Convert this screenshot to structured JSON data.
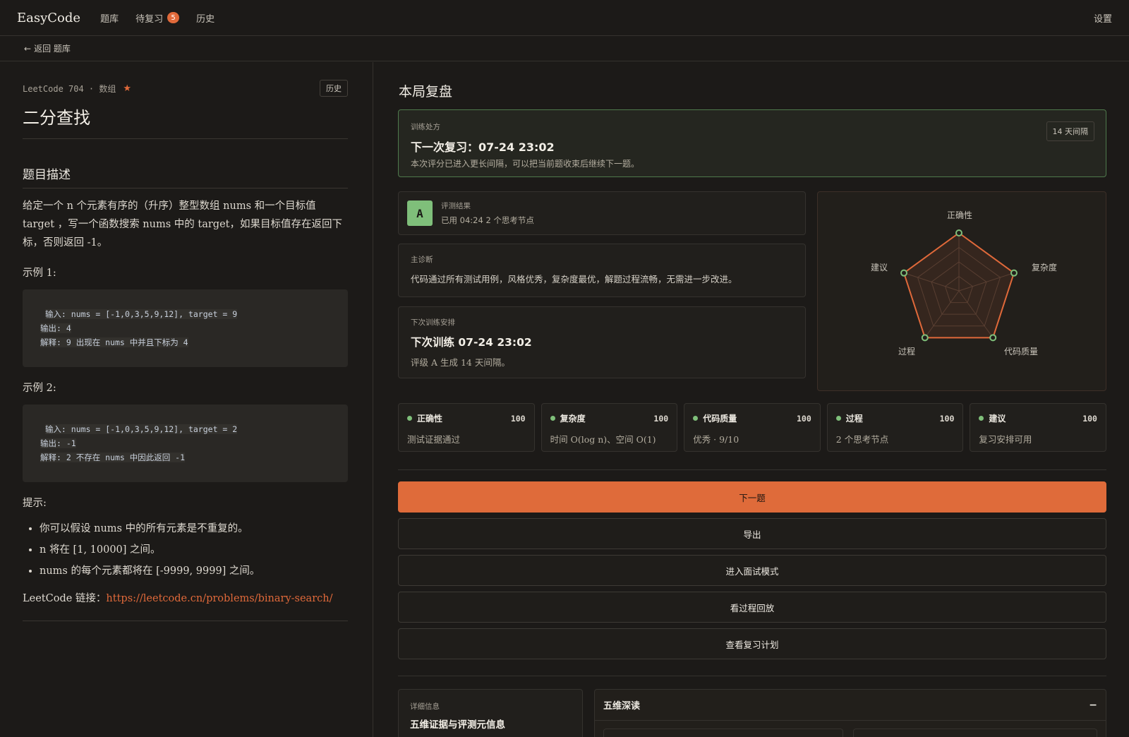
{
  "header": {
    "brand": "EasyCode",
    "nav": [
      {
        "label": "题库"
      },
      {
        "label": "待复习",
        "badge": "5"
      },
      {
        "label": "历史"
      }
    ],
    "settings": "设置"
  },
  "subbar": {
    "back_arrow": "←",
    "back_label": "返回 题库"
  },
  "problem": {
    "meta": "LeetCode 704 · 数组",
    "star": "★",
    "history_button": "历史",
    "title": "二分查找",
    "section_title": "题目描述",
    "description": "给定一个 n 个元素有序的（升序）整型数组 nums 和一个目标值 target ，写一个函数搜索 nums 中的 target，如果目标值存在返回下标，否则返回 -1。",
    "examples": [
      {
        "label": "示例 1:",
        "input": "输入: nums = [-1,0,3,5,9,12], target = 9",
        "output": "输出: 4",
        "explain": "解释: 9 出现在 nums 中并且下标为 4"
      },
      {
        "label": "示例 2:",
        "input": "输入: nums = [-1,0,3,5,9,12], target = 2",
        "output": "输出: -1",
        "explain": "解释: 2 不存在 nums 中因此返回 -1"
      }
    ],
    "tips_label": "提示:",
    "tips": [
      "你可以假设 nums 中的所有元素是不重复的。",
      "n 将在 [1, 10000] 之间。",
      "nums 的每个元素都将在 [-9999, 9999] 之间。"
    ],
    "link_label": "LeetCode 链接：",
    "link_url": "https://leetcode.cn/problems/binary-search/"
  },
  "review": {
    "heading": "本局复盘",
    "prescription": {
      "label": "训练处方",
      "title": "下一次复习：07-24 23:02",
      "subtitle": "本次评分已进入更长间隔，可以把当前题收束后继续下一题。",
      "interval": "14 天间隔"
    },
    "result": {
      "grade": "A",
      "label": "评测结果",
      "sub": "已用 04:24  2 个思考节点"
    },
    "diagnosis": {
      "label": "主诊断",
      "text": "代码通过所有测试用例，风格优秀，复杂度最优，解题过程流畅，无需进一步改进。"
    },
    "next": {
      "label": "下次训练安排",
      "title": "下次训练 07-24 23:02",
      "sub": "评级 A 生成 14 天间隔。"
    },
    "radar": {
      "axes": [
        "正确性",
        "复杂度",
        "代码质量",
        "过程",
        "建议"
      ],
      "values": [
        100,
        100,
        100,
        100,
        100
      ],
      "max": 100,
      "color": "#e0693a",
      "point_color": "#7fbf7a"
    },
    "dimensions": [
      {
        "name": "正确性",
        "score": "100",
        "sub": "测试证据通过"
      },
      {
        "name": "复杂度",
        "score": "100",
        "sub": "时间 O(log n)、空间 O(1)"
      },
      {
        "name": "代码质量",
        "score": "100",
        "sub": "优秀 · 9/10"
      },
      {
        "name": "过程",
        "score": "100",
        "sub": "2 个思考节点"
      },
      {
        "name": "建议",
        "score": "100",
        "sub": "复习安排可用"
      }
    ],
    "actions": [
      "下一题",
      "导出",
      "进入面试模式",
      "看过程回放",
      "查看复习计划"
    ],
    "detail": {
      "label": "详细信息",
      "title": "五维证据与评测元信息"
    },
    "deep": {
      "title": "五维深读",
      "toggle": "−"
    }
  }
}
